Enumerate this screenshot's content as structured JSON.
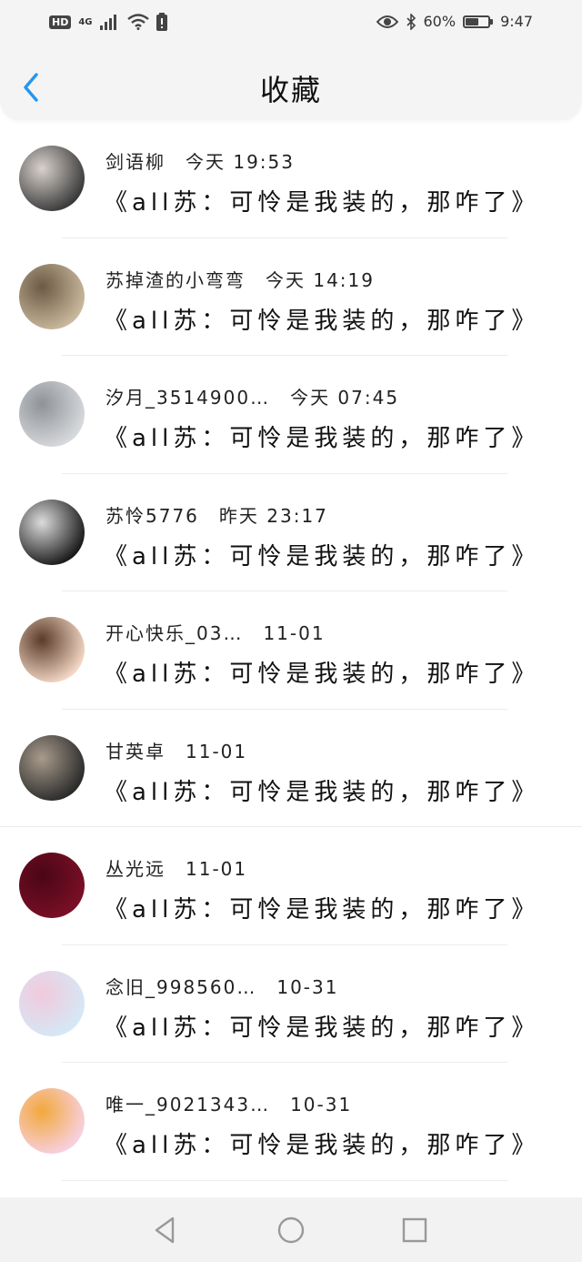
{
  "status_bar": {
    "hd": "HD",
    "network": "4G",
    "battery_percent": "60%",
    "battery_level": 0.6,
    "time": "9:47"
  },
  "header": {
    "title": "收藏",
    "back_icon": "chevron-left-icon",
    "accent": "#2196f3"
  },
  "favorites": [
    {
      "user": "剑语柳",
      "time": "今天 19:53",
      "title": "《all苏：可怜是我装的，那咋了》",
      "avatar_colors": [
        "#3a3a3a",
        "#d9d2cc"
      ]
    },
    {
      "user": "苏掉渣的小弯弯",
      "time": "今天 14:19",
      "title": "《all苏：可怜是我装的，那咋了》",
      "avatar_colors": [
        "#c9b89c",
        "#6b5a45"
      ]
    },
    {
      "user": "汐月_3514900…",
      "time": "今天 07:45",
      "title": "《all苏：可怜是我装的，那咋了》",
      "avatar_colors": [
        "#d7d9dc",
        "#8f9398"
      ]
    },
    {
      "user": "苏怜5776",
      "time": "昨天 23:17",
      "title": "《all苏：可怜是我装的，那咋了》",
      "avatar_colors": [
        "#1a1a1a",
        "#dcdcdc"
      ]
    },
    {
      "user": "开心快乐_03…",
      "time": "11-01",
      "title": "《all苏：可怜是我装的，那咋了》",
      "avatar_colors": [
        "#f3d6c4",
        "#5a3b2a"
      ]
    },
    {
      "user": "甘英卓",
      "time": "11-01",
      "title": "《all苏：可怜是我装的，那咋了》",
      "avatar_colors": [
        "#2b2b2b",
        "#a89b8c"
      ]
    },
    {
      "user": "丛光远",
      "time": "11-01",
      "title": "《all苏：可怜是我装的，那咋了》",
      "avatar_colors": [
        "#7a0f26",
        "#4a0616"
      ]
    },
    {
      "user": "念旧_998560…",
      "time": "10-31",
      "title": "《all苏：可怜是我装的，那咋了》",
      "avatar_colors": [
        "#d4e8f5",
        "#f2c9dc"
      ]
    },
    {
      "user": "唯一_9021343…",
      "time": "10-31",
      "title": "《all苏：可怜是我装的，那咋了》",
      "avatar_colors": [
        "#f7d0e0",
        "#f2a83b"
      ]
    }
  ],
  "nav_bar": {
    "back_icon": "triangle-back-icon",
    "home_icon": "circle-home-icon",
    "recents_icon": "square-recents-icon"
  }
}
